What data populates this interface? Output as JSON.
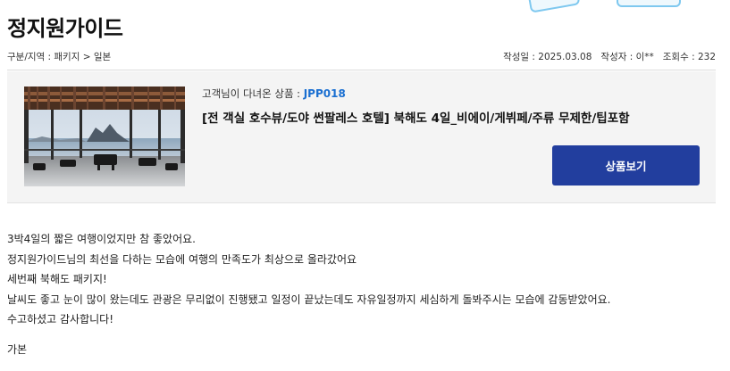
{
  "header": {
    "title": "정지원가이드"
  },
  "meta": {
    "category": "구분/지역 : 패키지 > 일본",
    "date": "작성일 : 2025.03.08",
    "author": "작성자 : 이**",
    "views": "조회수 : 232"
  },
  "product": {
    "review_label": "고객님이 다녀온 상품 : ",
    "code": "JPP018",
    "name": "[전 객실 호수뷰/도야 썬팔레스 호텔] 북해도 4일_비에이/게뷔페/주류 무제한/팁포함",
    "view_button": "상품보기",
    "thumbnail_icon": "hotel-lake-view-photo"
  },
  "review": {
    "lines": [
      "3박4일의 짧은 여행이었지만 참 좋았어요.",
      "정지원가이드님의 최선을 다하는 모습에 여행의 만족도가 최상으로 올라갔어요",
      "세번째 북해도 패키지!",
      "날씨도 좋고 눈이 많이 왔는데도 관광은 무리없이 진행됐고 일정이 끝났는데도 자유일정까지 세심하게 돌봐주시는 모습에 감동받았어요.",
      "수고하셨고 감사합니다!"
    ],
    "signature": "가본"
  },
  "colors": {
    "accent_button": "#223e9e",
    "product_code": "#1a6fd1",
    "box_background": "#f4f4f4"
  }
}
